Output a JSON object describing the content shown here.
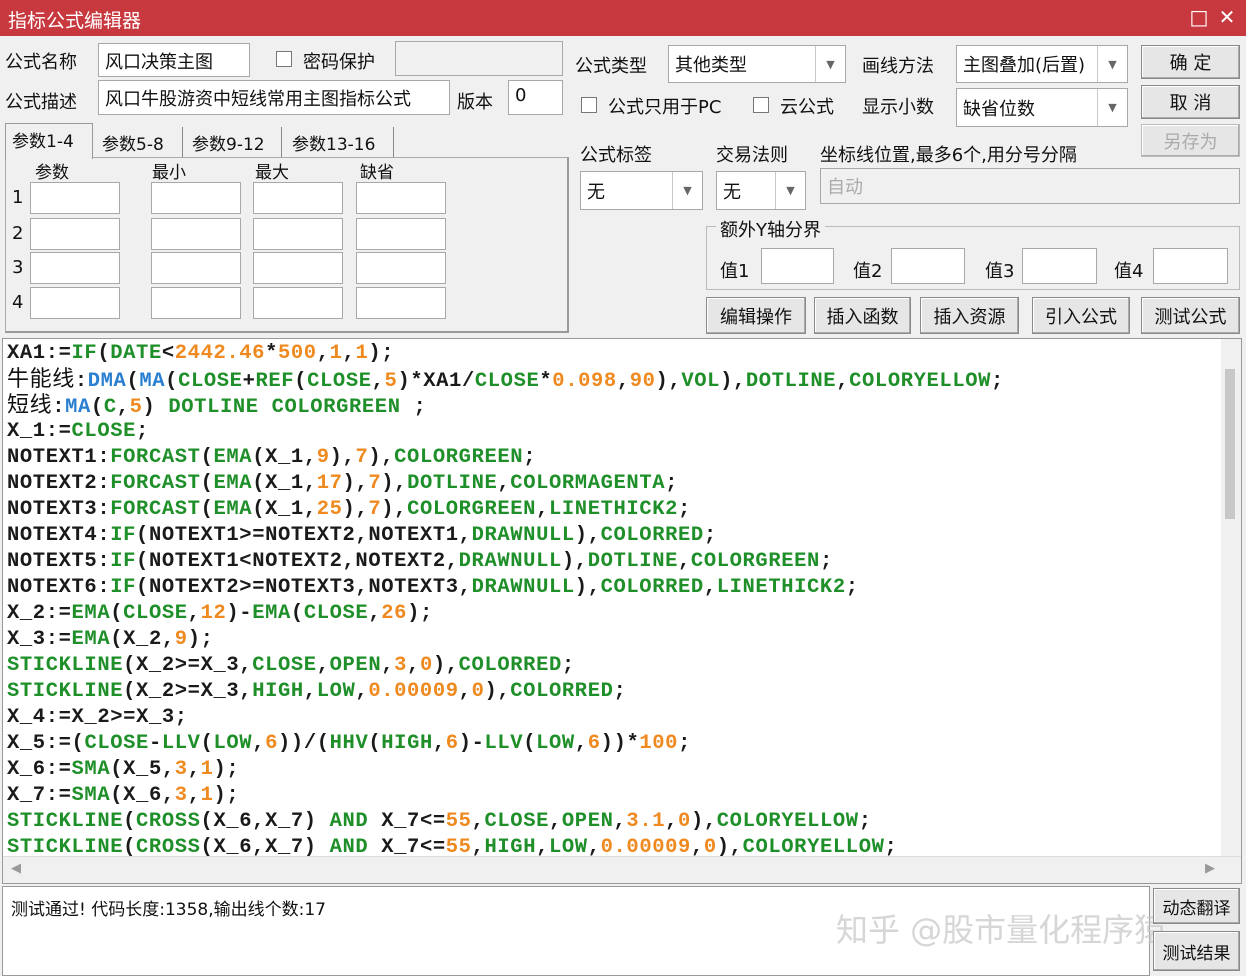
{
  "window": {
    "title": "指标公式编辑器",
    "maximize_icon": "□",
    "close_icon": "✕"
  },
  "form": {
    "name_label": "公式名称",
    "name_value": "风口决策主图",
    "password_label": "密码保护",
    "password_value": "",
    "desc_label": "公式描述",
    "desc_value": "风口牛股游资中短线常用主图指标公式",
    "version_label": "版本",
    "version_value": "0",
    "type_label": "公式类型",
    "type_value": "其他类型",
    "draw_label": "画线方法",
    "draw_value": "主图叠加(后置)",
    "pc_only_label": "公式只用于PC",
    "cloud_label": "云公式",
    "decimal_label": "显示小数",
    "decimal_value": "缺省位数",
    "tag_label": "公式标签",
    "tag_value": "无",
    "trade_label": "交易法则",
    "trade_value": "无",
    "axis_label": "坐标线位置,最多6个,用分号分隔",
    "axis_placeholder": "自动",
    "extra_y_label": "额外Y轴分界",
    "y_values": [
      "值1",
      "值2",
      "值3",
      "值4"
    ]
  },
  "tabs": [
    "参数1-4",
    "参数5-8",
    "参数9-12",
    "参数13-16"
  ],
  "params": {
    "headers": [
      "参数",
      "最小",
      "最大",
      "缺省"
    ],
    "rows": [
      "1",
      "2",
      "3",
      "4"
    ]
  },
  "buttons": {
    "ok": "确  定",
    "cancel": "取  消",
    "save_as": "另存为",
    "edit": "编辑操作",
    "insert_func": "插入函数",
    "insert_res": "插入资源",
    "import": "引入公式",
    "test": "测试公式",
    "translate": "动态翻译",
    "test_result": "测试结果"
  },
  "code": {
    "lines": [
      "XA1:=IF(DATE<2442.46*500,1,1);",
      "牛能线:DMA(MA(CLOSE+REF(CLOSE,5)*XA1/CLOSE*0.098,90),VOL),DOTLINE,COLORYELLOW;",
      "短线:MA(C,5) DOTLINE COLORGREEN ;",
      "X_1:=CLOSE;",
      "NOTEXT1:FORCAST(EMA(X_1,9),7),COLORGREEN;",
      "NOTEXT2:FORCAST(EMA(X_1,17),7),DOTLINE,COLORMAGENTA;",
      "NOTEXT3:FORCAST(EMA(X_1,25),7),COLORGREEN,LINETHICK2;",
      "NOTEXT4:IF(NOTEXT1>=NOTEXT2,NOTEXT1,DRAWNULL),COLORRED;",
      "NOTEXT5:IF(NOTEXT1<NOTEXT2,NOTEXT2,DRAWNULL),DOTLINE,COLORGREEN;",
      "NOTEXT6:IF(NOTEXT2>=NOTEXT3,NOTEXT3,DRAWNULL),COLORRED,LINETHICK2;",
      "X_2:=EMA(CLOSE,12)-EMA(CLOSE,26);",
      "X_3:=EMA(X_2,9);",
      "STICKLINE(X_2>=X_3,CLOSE,OPEN,3,0),COLORRED;",
      "STICKLINE(X_2>=X_3,HIGH,LOW,0.00009,0),COLORRED;",
      "X_4:=X_2>=X_3;",
      "X_5:=(CLOSE-LLV(LOW,6))/(HHV(HIGH,6)-LLV(LOW,6))*100;",
      "X_6:=SMA(X_5,3,1);",
      "X_7:=SMA(X_6,3,1);",
      "STICKLINE(CROSS(X_6,X_7) AND X_7<=55,CLOSE,OPEN,3.1,0),COLORYELLOW;",
      "STICKLINE(CROSS(X_6,X_7) AND X_7<=55,HIGH,LOW,0.00009,0),COLORYELLOW;"
    ]
  },
  "output": {
    "message": "测试通过! 代码长度:1358,输出线个数:17"
  },
  "watermark": "知乎 @股市量化程序猿",
  "colors": {
    "title_bar": "#c8393f",
    "keyword": "#1f8f2a",
    "number": "#ee8a20",
    "builtin_blue": "#2a7fd0"
  }
}
